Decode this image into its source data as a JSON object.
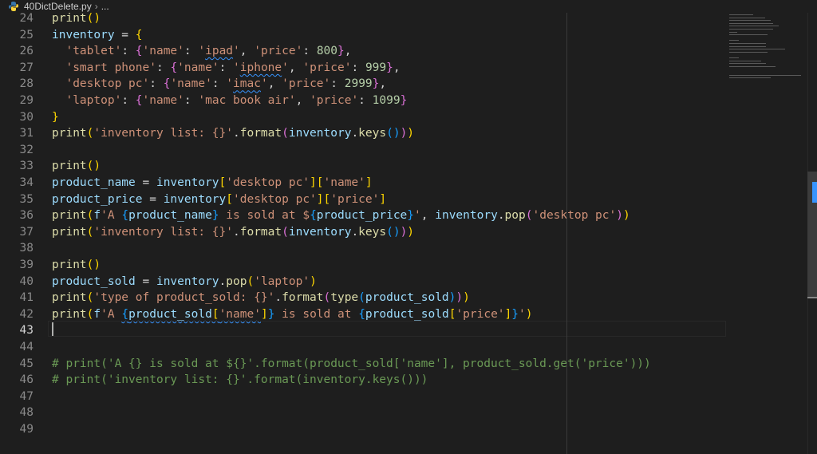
{
  "breadcrumb": {
    "file": "40DictDelete.py",
    "more": "..."
  },
  "editor": {
    "active_line": "43",
    "lines": [
      {
        "n": "24",
        "t": [
          [
            "fn",
            "print"
          ],
          [
            "b1",
            "()"
          ]
        ]
      },
      {
        "n": "25",
        "t": [
          [
            "v",
            "inventory"
          ],
          [
            "",
            " = "
          ],
          [
            "b1",
            "{"
          ]
        ]
      },
      {
        "n": "26",
        "t": [
          [
            "",
            "  "
          ],
          [
            "s",
            "'tablet'"
          ],
          [
            "",
            ": "
          ],
          [
            "b2",
            "{"
          ],
          [
            "s",
            "'name'"
          ],
          [
            "",
            ": "
          ],
          [
            "s",
            "'"
          ],
          [
            "s sq",
            "ipad"
          ],
          [
            "s",
            "'"
          ],
          [
            "",
            ", "
          ],
          [
            "s",
            "'price'"
          ],
          [
            "",
            ": "
          ],
          [
            "n",
            "800"
          ],
          [
            "b2",
            "}"
          ],
          [
            "",
            ","
          ]
        ]
      },
      {
        "n": "27",
        "t": [
          [
            "",
            "  "
          ],
          [
            "s",
            "'smart phone'"
          ],
          [
            "",
            ": "
          ],
          [
            "b2",
            "{"
          ],
          [
            "s",
            "'name'"
          ],
          [
            "",
            ": "
          ],
          [
            "s",
            "'"
          ],
          [
            "s sq",
            "iphone"
          ],
          [
            "s",
            "'"
          ],
          [
            "",
            ", "
          ],
          [
            "s",
            "'price'"
          ],
          [
            "",
            ": "
          ],
          [
            "n",
            "999"
          ],
          [
            "b2",
            "}"
          ],
          [
            "",
            ","
          ]
        ]
      },
      {
        "n": "28",
        "t": [
          [
            "",
            "  "
          ],
          [
            "s",
            "'desktop pc'"
          ],
          [
            "",
            ": "
          ],
          [
            "b2",
            "{"
          ],
          [
            "s",
            "'name'"
          ],
          [
            "",
            ": "
          ],
          [
            "s",
            "'"
          ],
          [
            "s sq",
            "imac"
          ],
          [
            "s",
            "'"
          ],
          [
            "",
            ", "
          ],
          [
            "s",
            "'price'"
          ],
          [
            "",
            ": "
          ],
          [
            "n",
            "2999"
          ],
          [
            "b2",
            "}"
          ],
          [
            "",
            ","
          ]
        ]
      },
      {
        "n": "29",
        "t": [
          [
            "",
            "  "
          ],
          [
            "s",
            "'laptop'"
          ],
          [
            "",
            ": "
          ],
          [
            "b2",
            "{"
          ],
          [
            "s",
            "'name'"
          ],
          [
            "",
            ": "
          ],
          [
            "s",
            "'mac book air'"
          ],
          [
            "",
            ", "
          ],
          [
            "s",
            "'price'"
          ],
          [
            "",
            ": "
          ],
          [
            "n",
            "1099"
          ],
          [
            "b2",
            "}"
          ]
        ]
      },
      {
        "n": "30",
        "t": [
          [
            "b1",
            "}"
          ]
        ]
      },
      {
        "n": "31",
        "t": [
          [
            "fn",
            "print"
          ],
          [
            "b1",
            "("
          ],
          [
            "s",
            "'inventory list: {}'"
          ],
          [
            "",
            "."
          ],
          [
            "fn",
            "format"
          ],
          [
            "b2",
            "("
          ],
          [
            "v",
            "inventory"
          ],
          [
            "",
            "."
          ],
          [
            "fn",
            "keys"
          ],
          [
            "b3",
            "()"
          ],
          [
            "b2",
            ")"
          ],
          [
            "b1",
            ")"
          ]
        ]
      },
      {
        "n": "32",
        "t": []
      },
      {
        "n": "33",
        "t": [
          [
            "fn",
            "print"
          ],
          [
            "b1",
            "()"
          ]
        ]
      },
      {
        "n": "34",
        "t": [
          [
            "v",
            "product_name"
          ],
          [
            "",
            " = "
          ],
          [
            "v",
            "inventory"
          ],
          [
            "b1",
            "["
          ],
          [
            "s",
            "'desktop pc'"
          ],
          [
            "b1",
            "]["
          ],
          [
            "s",
            "'name'"
          ],
          [
            "b1",
            "]"
          ]
        ]
      },
      {
        "n": "35",
        "t": [
          [
            "v",
            "product_price"
          ],
          [
            "",
            " = "
          ],
          [
            "v",
            "inventory"
          ],
          [
            "b1",
            "["
          ],
          [
            "s",
            "'desktop pc'"
          ],
          [
            "b1",
            "]["
          ],
          [
            "s",
            "'price'"
          ],
          [
            "b1",
            "]"
          ]
        ]
      },
      {
        "n": "36",
        "t": [
          [
            "fn",
            "print"
          ],
          [
            "b1",
            "("
          ],
          [
            "v",
            "f"
          ],
          [
            "s",
            "'A "
          ],
          [
            "b3",
            "{"
          ],
          [
            "v",
            "product_name"
          ],
          [
            "b3",
            "}"
          ],
          [
            "s",
            " is sold at $"
          ],
          [
            "b3",
            "{"
          ],
          [
            "v",
            "product_price"
          ],
          [
            "b3",
            "}"
          ],
          [
            "s",
            "'"
          ],
          [
            "",
            ", "
          ],
          [
            "v",
            "inventory"
          ],
          [
            "",
            "."
          ],
          [
            "fn",
            "pop"
          ],
          [
            "b2",
            "("
          ],
          [
            "s",
            "'desktop pc'"
          ],
          [
            "b2",
            ")"
          ],
          [
            "b1",
            ")"
          ]
        ]
      },
      {
        "n": "37",
        "t": [
          [
            "fn",
            "print"
          ],
          [
            "b1",
            "("
          ],
          [
            "s",
            "'inventory list: {}'"
          ],
          [
            "",
            "."
          ],
          [
            "fn",
            "format"
          ],
          [
            "b2",
            "("
          ],
          [
            "v",
            "inventory"
          ],
          [
            "",
            "."
          ],
          [
            "fn",
            "keys"
          ],
          [
            "b3",
            "()"
          ],
          [
            "b2",
            ")"
          ],
          [
            "b1",
            ")"
          ]
        ]
      },
      {
        "n": "38",
        "t": []
      },
      {
        "n": "39",
        "t": [
          [
            "fn",
            "print"
          ],
          [
            "b1",
            "()"
          ]
        ]
      },
      {
        "n": "40",
        "t": [
          [
            "v",
            "product_sold"
          ],
          [
            "",
            " = "
          ],
          [
            "v",
            "inventory"
          ],
          [
            "",
            "."
          ],
          [
            "fn",
            "pop"
          ],
          [
            "b1",
            "("
          ],
          [
            "s",
            "'laptop'"
          ],
          [
            "b1",
            ")"
          ]
        ]
      },
      {
        "n": "41",
        "t": [
          [
            "fn",
            "print"
          ],
          [
            "b1",
            "("
          ],
          [
            "s",
            "'type of product_sold: {}'"
          ],
          [
            "",
            "."
          ],
          [
            "fn",
            "format"
          ],
          [
            "b2",
            "("
          ],
          [
            "fn",
            "type"
          ],
          [
            "b3",
            "("
          ],
          [
            "v",
            "product_sold"
          ],
          [
            "b3",
            ")"
          ],
          [
            "b2",
            ")"
          ],
          [
            "b1",
            ")"
          ]
        ]
      },
      {
        "n": "42",
        "t": [
          [
            "fn",
            "print"
          ],
          [
            "b1",
            "("
          ],
          [
            "v",
            "f"
          ],
          [
            "s",
            "'A "
          ],
          [
            "b3 sq",
            "{"
          ],
          [
            "v sq",
            "product_sold"
          ],
          [
            "b1 sq",
            "["
          ],
          [
            "s sq",
            "'name'"
          ],
          [
            "b1",
            "]"
          ],
          [
            "b3",
            "}"
          ],
          [
            "s",
            " is sold at "
          ],
          [
            "b3",
            "{"
          ],
          [
            "v",
            "product_sold"
          ],
          [
            "b1",
            "["
          ],
          [
            "s",
            "'price'"
          ],
          [
            "b1",
            "]"
          ],
          [
            "b3",
            "}"
          ],
          [
            "s",
            "'"
          ],
          [
            "b1",
            ")"
          ]
        ]
      },
      {
        "n": "43",
        "t": []
      },
      {
        "n": "44",
        "t": []
      },
      {
        "n": "45",
        "t": [
          [
            "cm",
            "# print('A {} is sold at ${}'.format(product_sold['name'], product_sold.get('price')))"
          ]
        ]
      },
      {
        "n": "46",
        "t": [
          [
            "cm",
            "# print('inventory list: {}'.format(inventory.keys()))"
          ]
        ]
      },
      {
        "n": "47",
        "t": []
      },
      {
        "n": "48",
        "t": []
      },
      {
        "n": "49",
        "t": []
      }
    ]
  },
  "colors": {
    "background": "#1e1e1e",
    "keyword_function": "#dcdcaa",
    "variable": "#9cdcfe",
    "string": "#ce9178",
    "number": "#b5cea8",
    "comment": "#6a9955",
    "bracket_1": "#ffd700",
    "bracket_2": "#da70d6",
    "bracket_3": "#179fff"
  },
  "icons": {
    "file_icon": "python-icon",
    "separator": "chevron-right-icon"
  }
}
